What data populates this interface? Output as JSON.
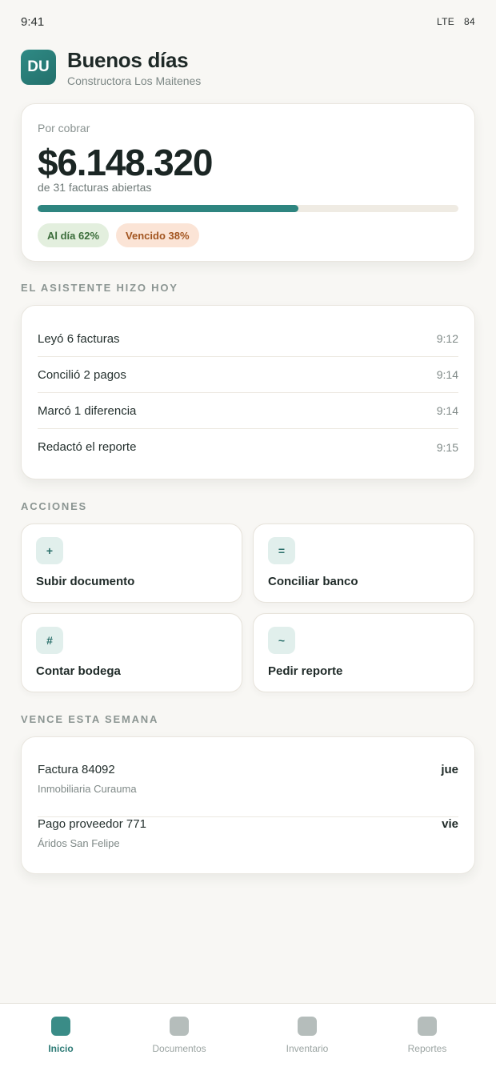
{
  "status_bar": {
    "time": "9:41",
    "network": "LTE",
    "battery": "84"
  },
  "header": {
    "avatar_initials": "DU",
    "greeting": "Buenos días",
    "company": "Constructora Los Maitenes"
  },
  "summary": {
    "label": "Por cobrar",
    "amount": "$6.148.320",
    "subtitle": "de 31 facturas abiertas",
    "progress_fraction": 0.62,
    "badge_ok": "Al día 62%",
    "badge_late": "Vencido 38%"
  },
  "activity": {
    "title": "EL ASISTENTE HIZO HOY",
    "items": [
      {
        "label": "Leyó 6 facturas",
        "time": "9:12"
      },
      {
        "label": "Concilió 2 pagos",
        "time": "9:14"
      },
      {
        "label": "Marcó 1 diferencia",
        "time": "9:14"
      },
      {
        "label": "Redactó el reporte",
        "time": "9:15"
      }
    ]
  },
  "actions": {
    "title": "ACCIONES",
    "items": [
      {
        "symbol": "+",
        "label": "Subir documento"
      },
      {
        "symbol": "=",
        "label": "Conciliar banco"
      },
      {
        "symbol": "#",
        "label": "Contar bodega"
      },
      {
        "symbol": "~",
        "label": "Pedir reporte"
      }
    ]
  },
  "due": {
    "title": "VENCE ESTA SEMANA",
    "items": [
      {
        "title": "Factura 84092",
        "subtitle": "Inmobiliaria Curauma",
        "day": "jue"
      },
      {
        "title": "Pago proveedor 771",
        "subtitle": "Áridos San Felipe",
        "day": "vie"
      }
    ]
  },
  "tabs": [
    {
      "label": "Inicio",
      "active": true,
      "icon": "home-icon"
    },
    {
      "label": "Documentos",
      "active": false,
      "icon": "documents-icon"
    },
    {
      "label": "Inventario",
      "active": false,
      "icon": "inventory-icon"
    },
    {
      "label": "Reportes",
      "active": false,
      "icon": "reports-icon"
    }
  ],
  "colors": {
    "accent": "#2e8580",
    "ok_bg": "#e3efde",
    "late_bg": "#fbe4d6",
    "background": "#f8f7f4"
  }
}
